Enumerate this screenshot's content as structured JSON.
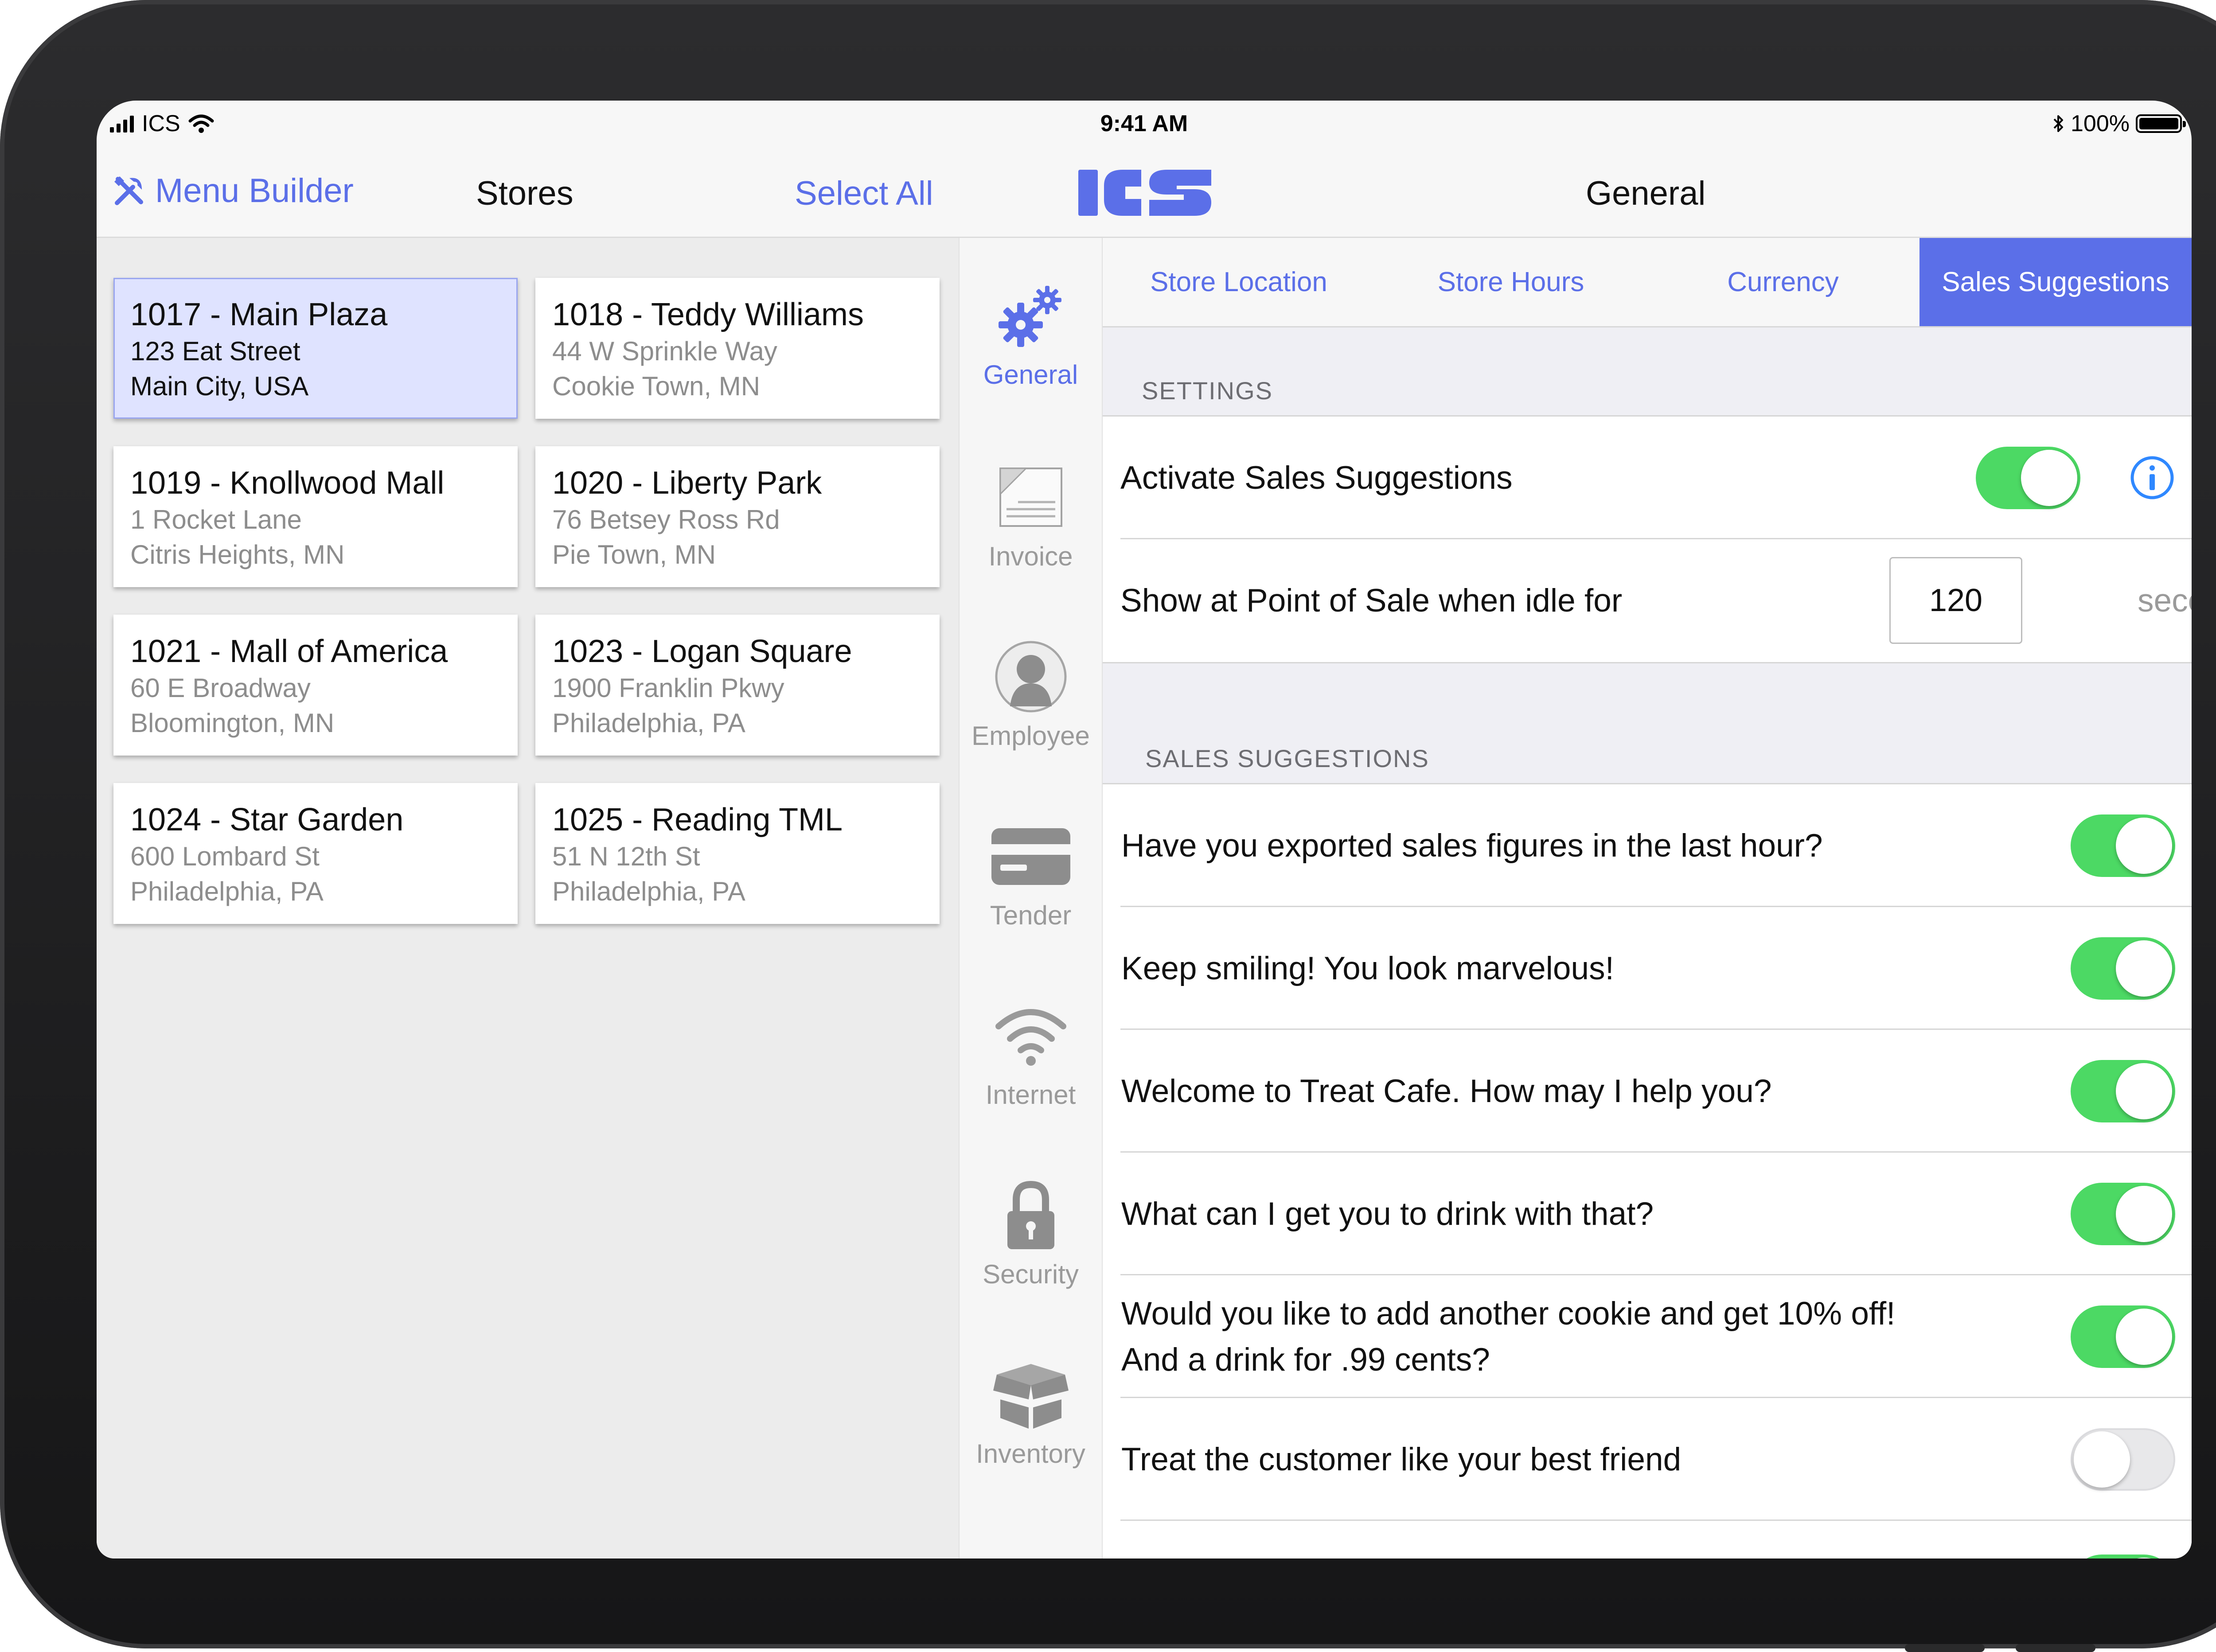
{
  "status_bar": {
    "carrier": "ICS",
    "time": "9:41 AM",
    "battery": "100%"
  },
  "nav": {
    "menu_builder": "Menu Builder",
    "stores": "Stores",
    "select_all": "Select All",
    "section_title": "General"
  },
  "stores": [
    {
      "title": "1017 - Main Plaza",
      "line1": "123 Eat Street",
      "line2": "Main City, USA",
      "selected": true
    },
    {
      "title": "1018 - Teddy Williams",
      "line1": "44 W Sprinkle Way",
      "line2": "Cookie Town, MN"
    },
    {
      "title": "1019 - Knollwood Mall",
      "line1": "1 Rocket Lane",
      "line2": "Citris Heights, MN"
    },
    {
      "title": "1020 - Liberty Park",
      "line1": "76 Betsey Ross Rd",
      "line2": "Pie Town, MN"
    },
    {
      "title": "1021 - Mall of America",
      "line1": "60 E Broadway",
      "line2": "Bloomington, MN"
    },
    {
      "title": "1023 - Logan Square",
      "line1": "1900 Franklin Pkwy",
      "line2": "Philadelphia, PA"
    },
    {
      "title": "1024 - Star Garden",
      "line1": "600 Lombard St",
      "line2": "Philadelphia, PA"
    },
    {
      "title": "1025 - Reading TML",
      "line1": "51 N 12th St",
      "line2": "Philadelphia, PA"
    }
  ],
  "rail": [
    {
      "label": "General",
      "icon": "gears-icon",
      "active": true
    },
    {
      "label": "Invoice",
      "icon": "invoice-icon"
    },
    {
      "label": "Employee",
      "icon": "employee-icon"
    },
    {
      "label": "Tender",
      "icon": "credit-card-icon"
    },
    {
      "label": "Internet",
      "icon": "wifi-icon"
    },
    {
      "label": "Security",
      "icon": "lock-icon"
    },
    {
      "label": "Inventory",
      "icon": "boxes-icon"
    }
  ],
  "tabs": [
    {
      "label": "Store Location"
    },
    {
      "label": "Store Hours"
    },
    {
      "label": "Currency"
    },
    {
      "label": "Sales Suggestions",
      "active": true
    }
  ],
  "settings": {
    "header": "SETTINGS",
    "activate_label": "Activate Sales Suggestions",
    "activate_on": true,
    "idle_label": "Show at Point of Sale when idle for",
    "idle_value": "120",
    "idle_unit": "seconds."
  },
  "suggestions": {
    "header": "SALES SUGGESTIONS",
    "items": [
      {
        "text": "Have you exported sales figures in the last hour?",
        "on": true
      },
      {
        "text": "Keep smiling! You look marvelous!",
        "on": true
      },
      {
        "text": "Welcome to Treat Cafe. How may I help you?",
        "on": true
      },
      {
        "text": "What can I get you to drink with that?",
        "on": true
      },
      {
        "text": "Would you like to add another cookie and get 10% off! And a drink for .99 cents?",
        "on": true
      },
      {
        "text": "Treat the customer like your best friend",
        "on": false
      }
    ]
  },
  "colors": {
    "accent": "#5b6fe8",
    "toggle_on": "#4cd964",
    "toggle_off": "#e8e8ea"
  }
}
